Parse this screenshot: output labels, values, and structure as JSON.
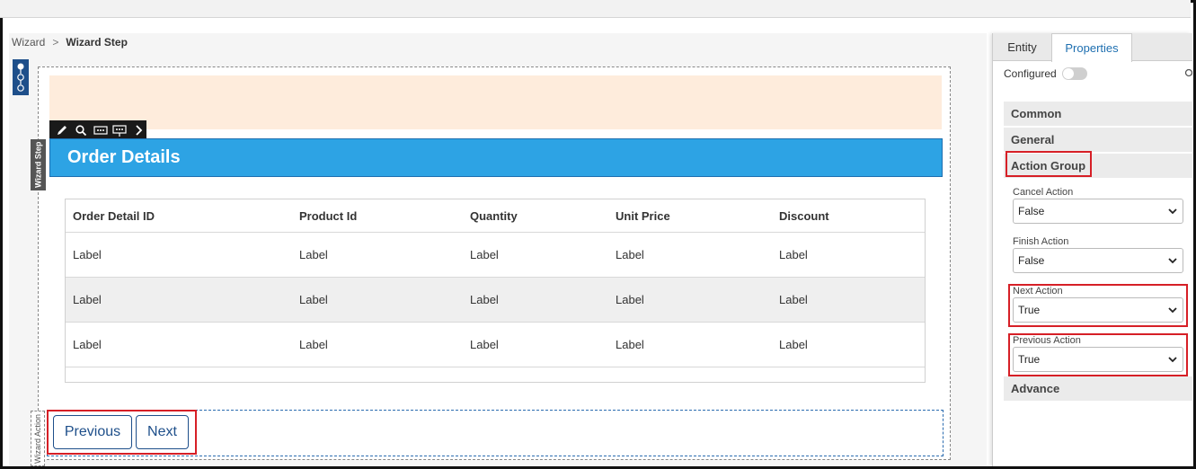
{
  "breadcrumb": {
    "root": "Wizard",
    "current": "Wizard Step"
  },
  "canvas": {
    "step_label": "Wizard Step",
    "action_label": "Wizard Action",
    "header_title": "Order Details",
    "table": {
      "columns": [
        "Order Detail ID",
        "Product Id",
        "Quantity",
        "Unit Price",
        "Discount"
      ],
      "rows": [
        [
          "Label",
          "Label",
          "Label",
          "Label",
          "Label"
        ],
        [
          "Label",
          "Label",
          "Label",
          "Label",
          "Label"
        ],
        [
          "Label",
          "Label",
          "Label",
          "Label",
          "Label"
        ]
      ]
    },
    "buttons": {
      "previous": "Previous",
      "next": "Next"
    }
  },
  "toolbar_icons": [
    "pencil-icon",
    "search-icon",
    "horizontal-layout-icon",
    "insert-layout-icon",
    "chevron-right-icon"
  ],
  "panel": {
    "tabs": {
      "entity": "Entity",
      "properties": "Properties"
    },
    "configured_label": "Configured",
    "configured_on": false,
    "sections": {
      "common": "Common",
      "general": "General",
      "action_group": "Action Group",
      "advance": "Advance"
    },
    "properties": {
      "cancel_action": {
        "label": "Cancel Action",
        "value": "False"
      },
      "finish_action": {
        "label": "Finish Action",
        "value": "False"
      },
      "next_action": {
        "label": "Next Action",
        "value": "True"
      },
      "previous_action": {
        "label": "Previous Action",
        "value": "True"
      }
    }
  },
  "colors": {
    "header_blue": "#2da3e4",
    "accent_navy": "#1e4f8a",
    "highlight_red": "#d61f26",
    "peach": "#feecdc"
  }
}
